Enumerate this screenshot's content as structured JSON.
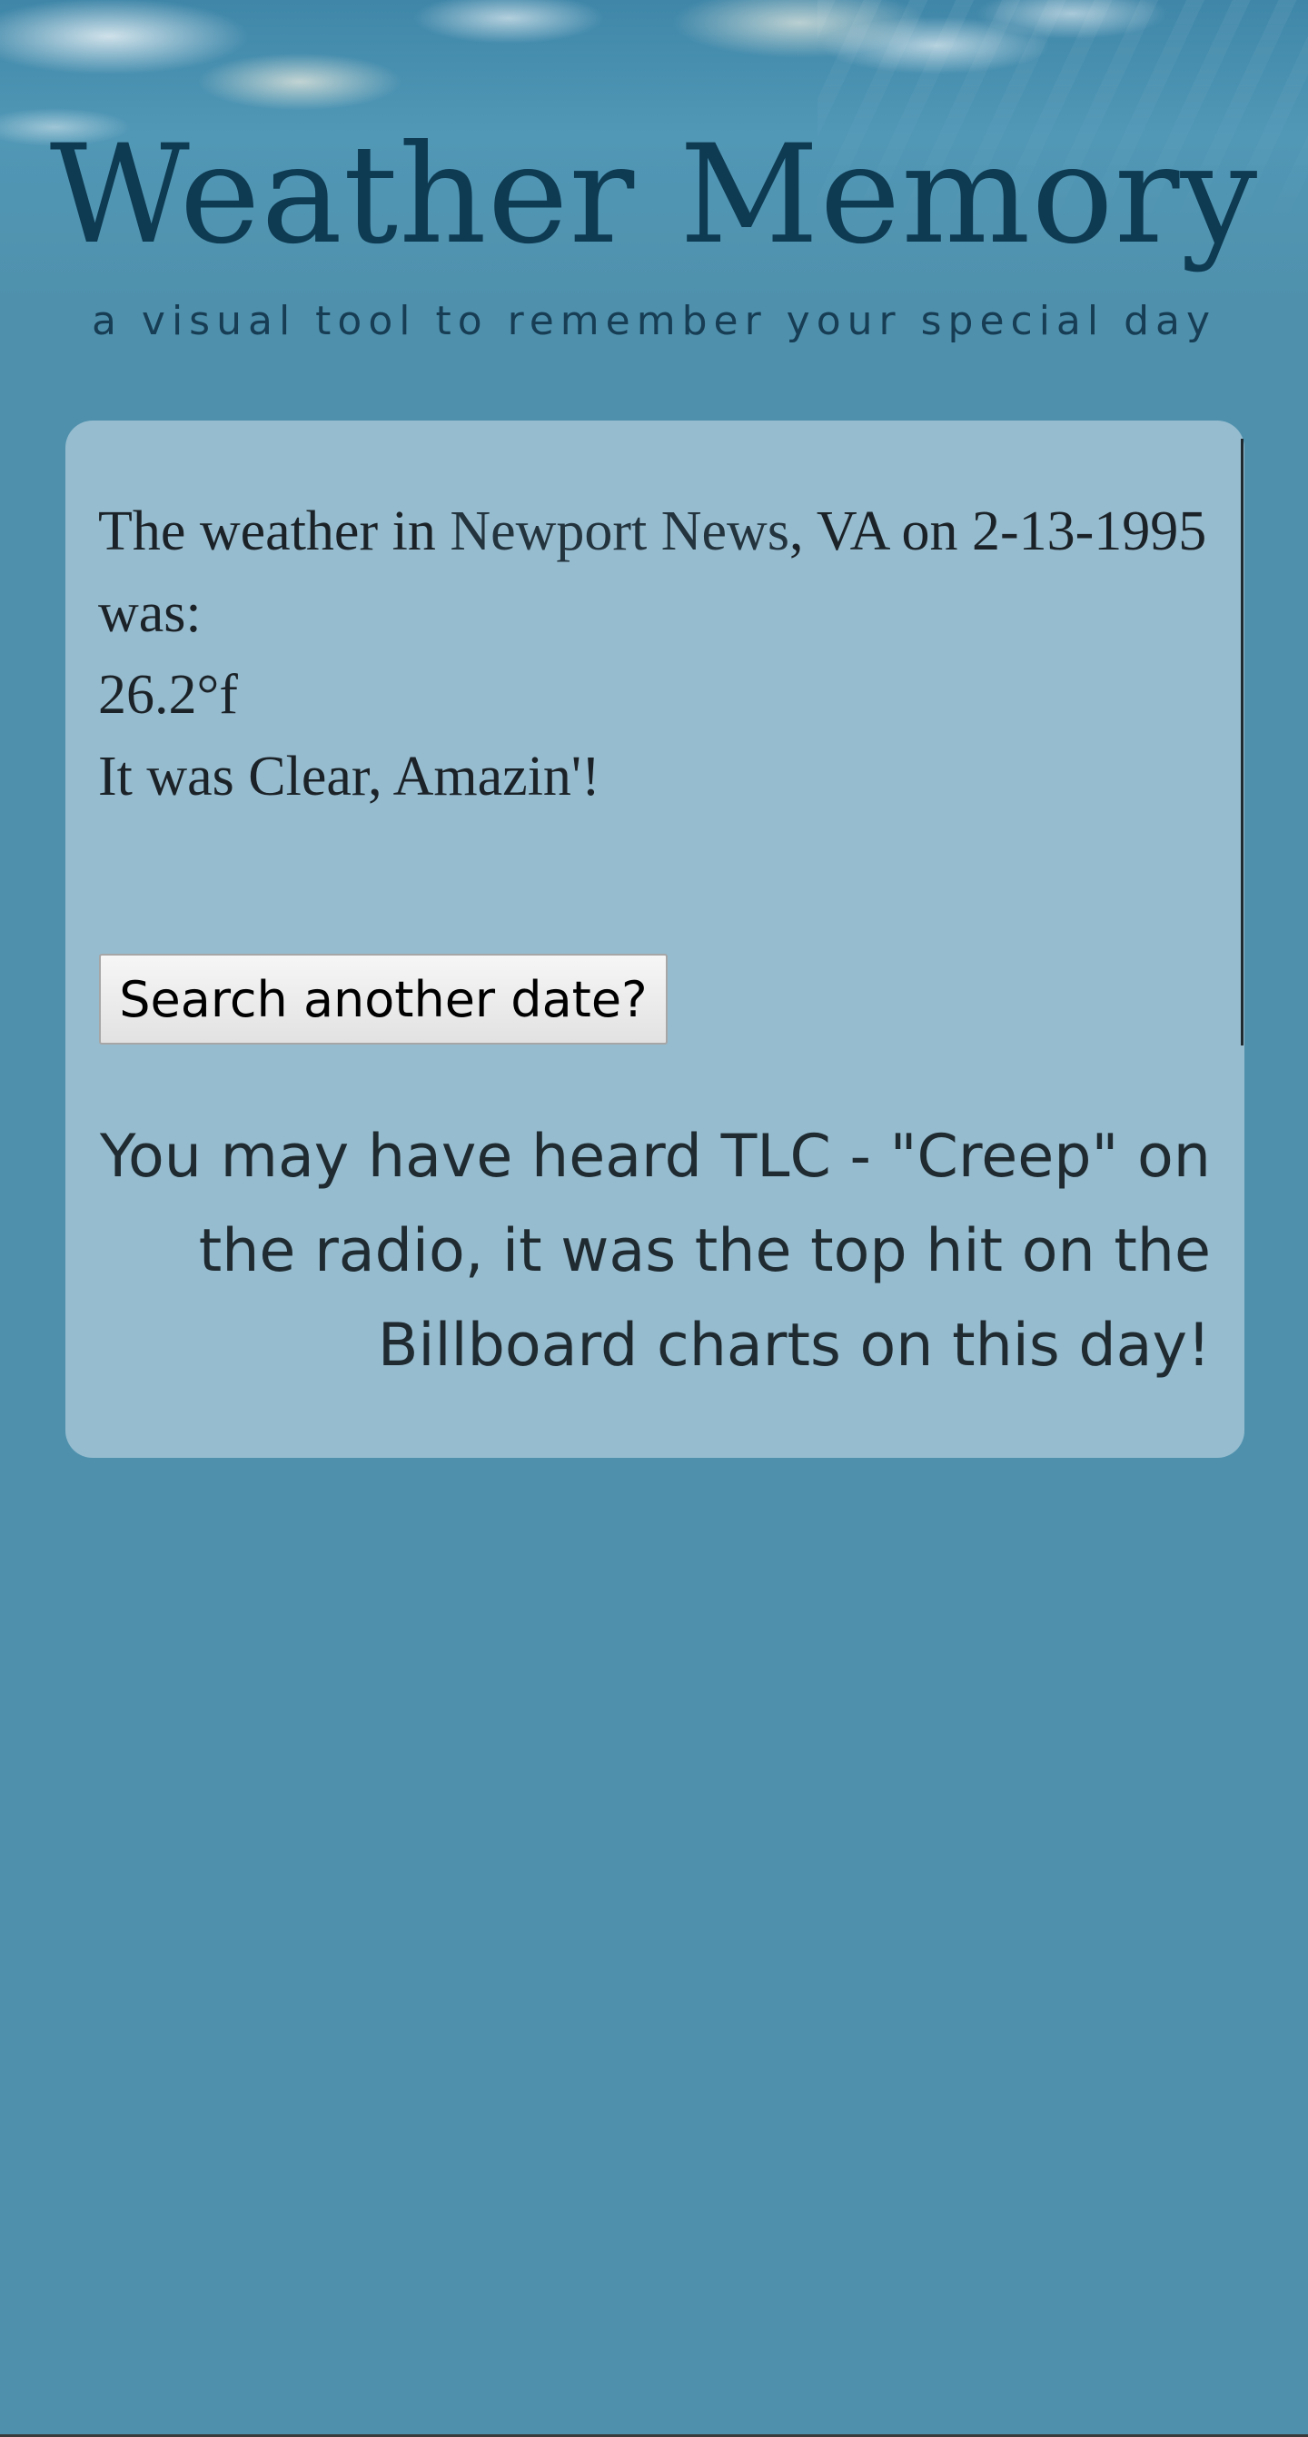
{
  "header": {
    "title": "Weather Memory",
    "tagline": "a visual tool to remember your special day"
  },
  "result": {
    "intro": "The weather in ",
    "city": "Newport News",
    "state_date": ", VA on 2-13-1995 was:",
    "temperature": "26.2°f",
    "condition": "It was Clear, Amazin'!"
  },
  "actions": {
    "search_again_label": "Search another date?"
  },
  "song": {
    "message": "You may have heard TLC - \"Creep\" on the radio, it was the top hit on the Billboard charts on this day!"
  },
  "colors": {
    "page_background": "#4f91ad",
    "card_background": "#96bccf",
    "title_color": "#0e3a52"
  }
}
